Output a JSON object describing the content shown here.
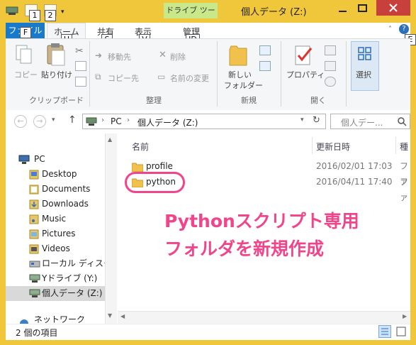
{
  "window": {
    "title": "個人データ (Z:)",
    "contextual_tab": "ドライブ ツール"
  },
  "qat": {
    "keytips": [
      "1",
      "2"
    ]
  },
  "tabs": [
    {
      "label": "ファイル",
      "keytip": "F"
    },
    {
      "label": "ホーム",
      "keytip": "H"
    },
    {
      "label": "共有",
      "keytip": "S"
    },
    {
      "label": "表示",
      "keytip": "V"
    },
    {
      "label": "管理",
      "keytip": "JD"
    }
  ],
  "ribbon_keytip_e": "E",
  "ribbon": {
    "clipboard": {
      "copy": "コピー",
      "paste": "貼り付け",
      "group": "クリップボード"
    },
    "organize": {
      "move_to": "移動先",
      "copy_to": "コピー先",
      "delete": "削除",
      "rename": "名前の変更",
      "group": "整理"
    },
    "new": {
      "new_folder_line1": "新しい",
      "new_folder_line2": "フォルダー",
      "group": "新規"
    },
    "open": {
      "properties": "プロパティ",
      "group": "開く"
    },
    "select": {
      "label": "選択"
    }
  },
  "address": {
    "pc": "PC",
    "sep": "›",
    "location": "個人データ (Z:)",
    "search_placeholder": "個人デー..."
  },
  "nav": {
    "items": [
      {
        "label": "PC",
        "icon": "pc-icon"
      },
      {
        "label": "Desktop",
        "icon": "folder-icon"
      },
      {
        "label": "Documents",
        "icon": "folder-icon"
      },
      {
        "label": "Downloads",
        "icon": "folder-icon"
      },
      {
        "label": "Music",
        "icon": "folder-icon"
      },
      {
        "label": "Pictures",
        "icon": "folder-icon"
      },
      {
        "label": "Videos",
        "icon": "folder-icon"
      },
      {
        "label": "ローカル ディスク (C",
        "icon": "drive-icon"
      },
      {
        "label": "Yドライブ (Y:)",
        "icon": "network-drive-icon"
      },
      {
        "label": "個人データ (Z:)",
        "icon": "network-drive-icon"
      },
      {
        "label": "ネットワーク",
        "icon": "network-icon"
      }
    ]
  },
  "columns": {
    "name": "名前",
    "date": "更新日時",
    "type": "種"
  },
  "files": [
    {
      "name": "profile",
      "date": "2016/02/01 17:03",
      "type": "ファ"
    },
    {
      "name": "python",
      "date": "2016/04/11 17:40",
      "type": "ファ"
    }
  ],
  "status": {
    "count": "2 個の項目"
  },
  "annotation": {
    "line1": "Pythonスクリプト専用",
    "line2": "フォルダを新規作成"
  },
  "colors": {
    "title_bar": "#f0c73a",
    "file_tab": "#1979ca",
    "contextual": "#c8e88a",
    "annotation": "#f2448a"
  }
}
